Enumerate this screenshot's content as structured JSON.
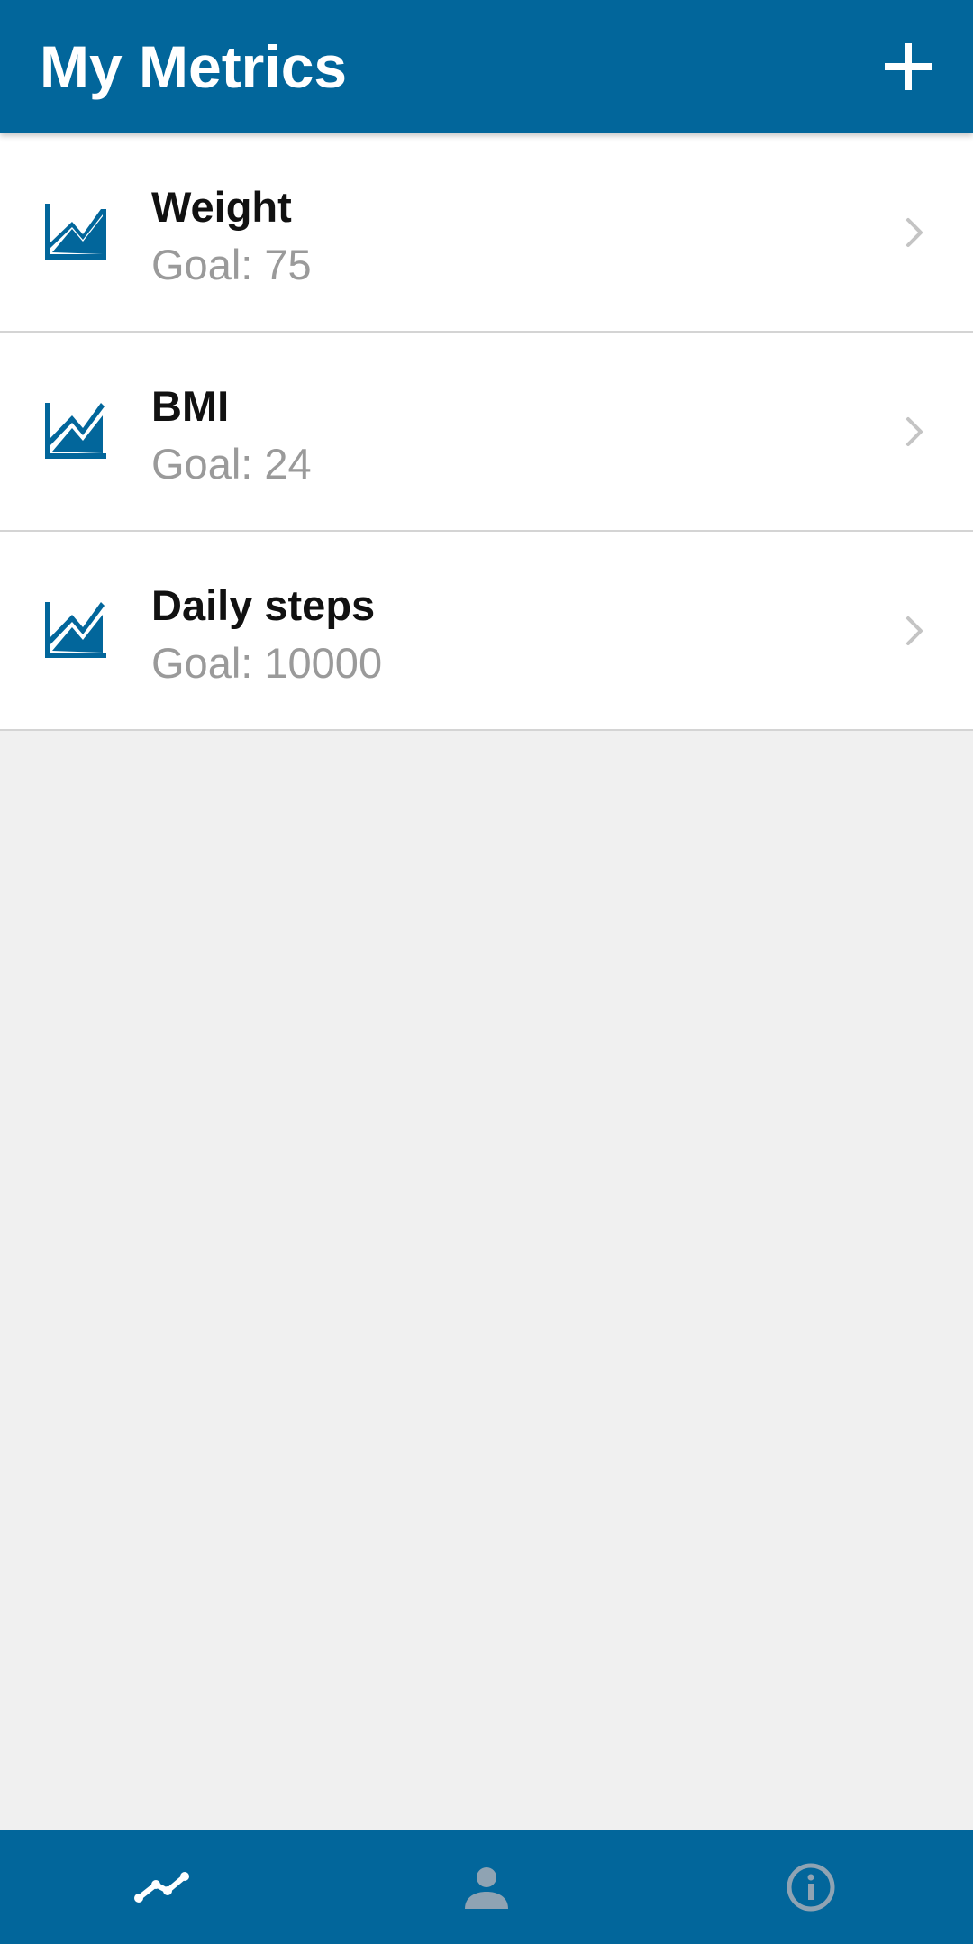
{
  "header": {
    "title": "My Metrics",
    "add_icon": "plus-icon"
  },
  "metrics": [
    {
      "name": "Weight",
      "goal": "Goal: 75",
      "icon": "area-chart-icon"
    },
    {
      "name": "BMI",
      "goal": "Goal: 24",
      "icon": "area-chart-icon"
    },
    {
      "name": "Daily steps",
      "goal": "Goal: 10000",
      "icon": "area-chart-icon"
    }
  ],
  "bottom_nav": {
    "items": [
      {
        "icon": "line-chart-icon",
        "active": true
      },
      {
        "icon": "person-icon",
        "active": false
      },
      {
        "icon": "info-icon",
        "active": false
      }
    ]
  },
  "colors": {
    "primary": "#02669b",
    "background": "#f0f0f0",
    "nav_active": "#ffffff",
    "nav_inactive": "#8fa3b3",
    "goal_text": "#9a9a9a",
    "divider": "#d4d4d4"
  }
}
